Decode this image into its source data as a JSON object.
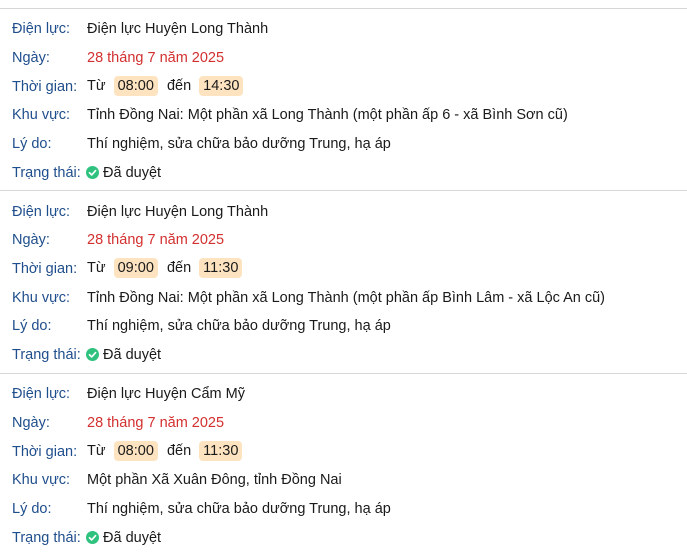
{
  "labels": {
    "provider": "Điện lực:",
    "date": "Ngày:",
    "time": "Thời gian:",
    "area": "Khu vực:",
    "reason": "Lý do:",
    "status": "Trạng thái:",
    "from_word": "Từ",
    "to_word": "đến"
  },
  "colors": {
    "label": "#1f4e8c",
    "date": "#d32f2f",
    "chip_bg": "#fde3c0",
    "status_icon": "#2ec27e"
  },
  "outages": [
    {
      "provider": "Điện lực Huyện Long Thành",
      "date": "28 tháng 7 năm 2025",
      "time_from": "08:00",
      "time_to": "14:30",
      "area": "Tỉnh Đồng Nai: Một phần xã Long Thành (một phần ấp 6 - xã Bình Sơn cũ)",
      "reason": "Thí nghiệm, sửa chữa bảo dưỡng Trung, hạ áp",
      "status": "Đã duyệt",
      "status_icon": "check-circle-icon"
    },
    {
      "provider": "Điện lực Huyện Long Thành",
      "date": "28 tháng 7 năm 2025",
      "time_from": "09:00",
      "time_to": "11:30",
      "area": "Tỉnh Đồng Nai: Một phần xã Long Thành (một phần ấp Bình Lâm - xã Lộc An cũ)",
      "reason": "Thí nghiệm, sửa chữa bảo dưỡng Trung, hạ áp",
      "status": "Đã duyệt",
      "status_icon": "check-circle-icon"
    },
    {
      "provider": "Điện lực Huyện Cẩm Mỹ",
      "date": "28 tháng 7 năm 2025",
      "time_from": "08:00",
      "time_to": "11:30",
      "area": "Một phần Xã Xuân Đông, tỉnh Đồng Nai",
      "reason": "Thí nghiệm, sửa chữa bảo dưỡng Trung, hạ áp",
      "status": "Đã duyệt",
      "status_icon": "check-circle-icon"
    }
  ]
}
